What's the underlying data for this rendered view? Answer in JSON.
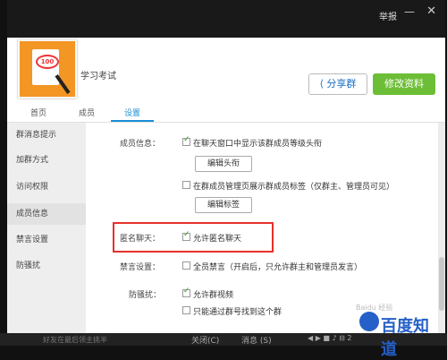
{
  "topbar": {
    "report_label": "举报",
    "minimize_glyph": "—",
    "close_glyph": "✕"
  },
  "header": {
    "group_name": "学习考试",
    "share_label": "分享群",
    "share_icon": "share-icon",
    "edit_label": "修改资料",
    "avatar_text": "100"
  },
  "tabs": [
    {
      "label": "首页"
    },
    {
      "label": "成员"
    },
    {
      "label": "设置"
    }
  ],
  "sidebar": {
    "items": [
      {
        "label": "群消息提示"
      },
      {
        "label": "加群方式"
      },
      {
        "label": "访问权限"
      },
      {
        "label": "成员信息"
      },
      {
        "label": "禁言设置"
      },
      {
        "label": "防骚扰"
      }
    ]
  },
  "settings": {
    "member_info_label": "成员信息：",
    "opt_show_level": "在聊天窗口中显示该群成员等级头衔",
    "edit_title_button": "编辑头衔",
    "opt_show_tags": "在群成员管理页展示群成员标签（仅群主、管理员可见）",
    "edit_tags_button": "编辑标签",
    "anon_label": "匿名聊天：",
    "opt_anon": "允许匿名聊天",
    "mute_label": "禁言设置：",
    "opt_mute_all": "全员禁言（开启后，只允许群主和管理员发言）",
    "anti_label": "防骚扰：",
    "opt_group_video": "允许群视频",
    "opt_find_by_number": "只能通过群号找到这个群"
  },
  "bottom": {
    "hint": "好友在最后领主挑半",
    "btn1": "关闭(C)",
    "btn2": "消息 (S)",
    "btn3": "◀ ▶ ■ ♪ ⊟ 2"
  },
  "watermark": {
    "text": "百度知道",
    "sub": "Baidu 经验"
  }
}
